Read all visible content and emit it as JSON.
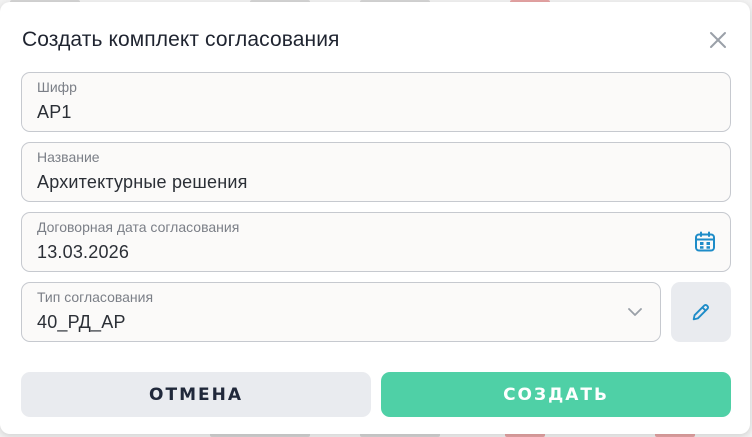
{
  "modal": {
    "title": "Создать комплект согласования"
  },
  "fields": {
    "code": {
      "label": "Шифр",
      "value": "АР1"
    },
    "name": {
      "label": "Название",
      "value": "Архитектурные решения"
    },
    "date": {
      "label": "Договорная дата согласования",
      "value": "13.03.2026"
    },
    "approval_type": {
      "label": "Тип согласования",
      "value": "40_РД_АР"
    }
  },
  "buttons": {
    "cancel": "ОТМЕНА",
    "create": "СОЗДАТЬ"
  },
  "icons": {
    "close": "close-icon",
    "calendar": "calendar-icon",
    "chevron": "chevron-down-icon",
    "edit": "pencil-icon"
  },
  "colors": {
    "accent": "#4fd0a6",
    "icon_blue": "#1e8cc8",
    "secondary_button": "#e9ebef"
  }
}
